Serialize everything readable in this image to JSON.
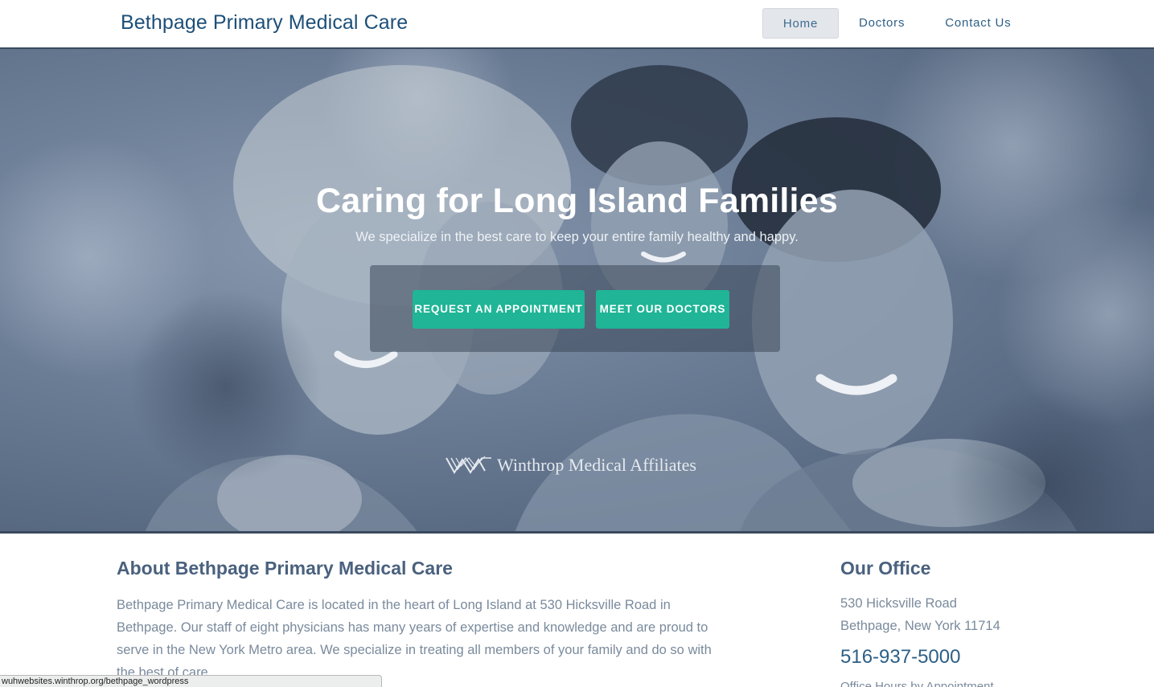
{
  "header": {
    "site_title": "Bethpage Primary Medical Care",
    "nav": [
      {
        "label": "Home",
        "active": true
      },
      {
        "label": "Doctors",
        "active": false
      },
      {
        "label": "Contact Us",
        "active": false
      }
    ]
  },
  "hero": {
    "title": "Caring for Long Island Families",
    "subtitle": "We specialize in the best care to keep your entire family healthy and happy.",
    "buttons": {
      "appointment": "REQUEST AN APPOINTMENT",
      "doctors": "MEET OUR DOCTORS"
    },
    "affiliate": "Winthrop Medical Affiliates",
    "background_image_icon": "family-photo"
  },
  "about": {
    "heading": "About Bethpage Primary Medical Care",
    "text": "Bethpage Primary Medical Care is located in the heart of Long Island at 530 Hicksville Road in Bethpage. Our staff of eight physicians has many years of expertise and knowledge and are proud to serve in the New York Metro area. We specialize in treating all members of your family and do so with the best of care."
  },
  "office": {
    "heading": "Our Office",
    "address_line1": "530 Hicksville Road",
    "address_line2": "Bethpage, New York 11714",
    "phone": "516-937-5000",
    "hours": "Office Hours by Appointment"
  },
  "status_bar": {
    "url": "wuhwebsites.winthrop.org/bethpage_wordpress"
  },
  "colors": {
    "accent": "#1fb596",
    "brand": "#1d4f78",
    "hero_overlay": "#5a6b84",
    "heading": "#4a617e",
    "body_text": "#7a8a9c"
  }
}
